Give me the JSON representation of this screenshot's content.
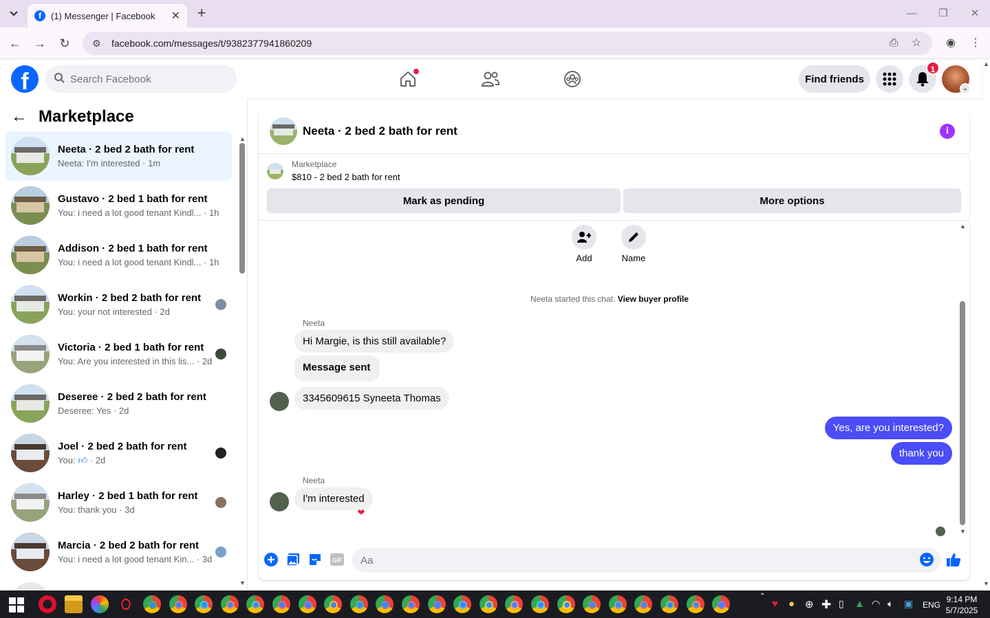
{
  "browser": {
    "tab_title": "(1) Messenger | Facebook",
    "url": "facebook.com/messages/t/9382377941860209"
  },
  "header": {
    "search_placeholder": "Search Facebook",
    "find_friends": "Find friends",
    "notification_count": "1"
  },
  "sidebar": {
    "title": "Marketplace",
    "conversations": [
      {
        "title": "Neeta · 2 bed 2 bath for rent",
        "snippet": "Neeta: I'm interested",
        "time": "1m",
        "active": true
      },
      {
        "title": "Gustavo · 2 bed 1 bath for rent",
        "snippet": "You: i need a lot good tenant Kindl...",
        "time": "1h"
      },
      {
        "title": "Addison · 2 bed 1 bath for rent",
        "snippet": "You: i need a lot good tenant Kindl...",
        "time": "1h"
      },
      {
        "title": "Workin · 2 bed 2 bath for rent",
        "snippet": "You: your not interested",
        "time": "2d"
      },
      {
        "title": "Victoria · 2 bed 1 bath for rent",
        "snippet": "You: Are you interested in this lis...",
        "time": "2d"
      },
      {
        "title": "Deseree · 2 bed 2 bath for rent",
        "snippet": "Deseree: Yes",
        "time": "2d"
      },
      {
        "title": "Joel · 2 bed 2 bath for rent",
        "snippet": "You:",
        "time": "2d"
      },
      {
        "title": "Harley · 2 bed 1 bath for rent",
        "snippet": "You: thank you",
        "time": "3d"
      },
      {
        "title": "Marcia · 2 bed 2 bath for rent",
        "snippet": "You: i need a lot good tenant Kin...",
        "time": "3d"
      }
    ]
  },
  "chat": {
    "title": "Neeta · 2 bed 2 bath for rent",
    "marketplace_label": "Marketplace",
    "listing": "$810 - 2 bed 2 bath for rent",
    "mark_pending": "Mark as pending",
    "more_options": "More options",
    "add_label": "Add",
    "name_label": "Name",
    "started_text": "Neeta started this chat.",
    "view_profile": "View buyer profile",
    "sender_name": "Neeta",
    "messages": [
      {
        "text": "Hi Margie, is this still available?",
        "dir": "in"
      },
      {
        "text": "Message sent",
        "dir": "in"
      },
      {
        "text": "3345609615 Syneeta Thomas",
        "dir": "in"
      },
      {
        "text": "Yes, are you interested?",
        "dir": "out"
      },
      {
        "text": "thank you",
        "dir": "out"
      },
      {
        "text": "I'm interested",
        "dir": "in"
      }
    ],
    "composer_placeholder": "Aa"
  },
  "taskbar": {
    "language": "ENG",
    "time": "9:14 PM",
    "date": "5/7/2025"
  },
  "colors": {
    "fb_blue": "#0866ff",
    "outgoing_bubble": "#4a4df8",
    "active_row": "#ebf5ff",
    "badge_red": "#e41e3f"
  }
}
